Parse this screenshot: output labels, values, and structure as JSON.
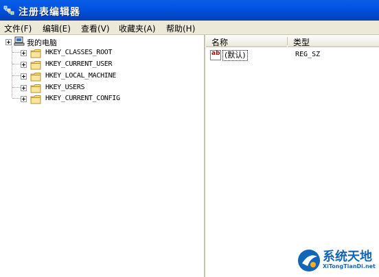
{
  "window": {
    "title": "注册表编辑器"
  },
  "menu": [
    "文件(F)",
    "编辑(E)",
    "查看(V)",
    "收藏夹(A)",
    "帮助(H)"
  ],
  "tree": {
    "root": "我的电脑",
    "keys": [
      "HKEY_CLASSES_ROOT",
      "HKEY_CURRENT_USER",
      "HKEY_LOCAL_MACHINE",
      "HKEY_USERS",
      "HKEY_CURRENT_CONFIG"
    ]
  },
  "list": {
    "columns": [
      "名称",
      "类型"
    ],
    "rows": [
      {
        "name": "(默认)",
        "type": "REG_SZ",
        "icon": "ab-string-icon"
      }
    ]
  },
  "watermark": {
    "brand": "系统天地",
    "url": "XiTongTianDi.net"
  },
  "colors": {
    "titlebar": "#0054e3",
    "menubar": "#ece9d8",
    "folder": "#f5d77a"
  }
}
